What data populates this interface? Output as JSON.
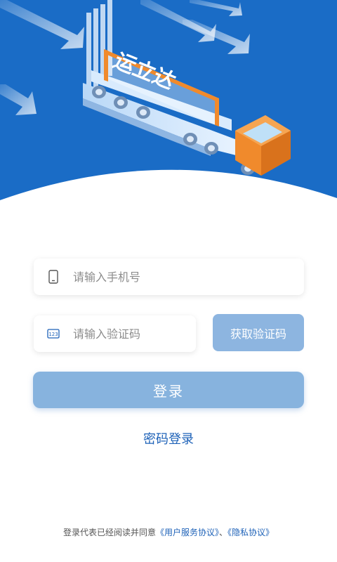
{
  "hero": {
    "brand_text": "运立达",
    "background_color": "#1a6cc6"
  },
  "login_form": {
    "phone_placeholder": "请输入手机号",
    "phone_value": "",
    "code_placeholder": "请输入验证码",
    "code_value": "",
    "get_code_label": "获取验证码",
    "login_label": "登录",
    "password_login_label": "密码登录"
  },
  "icons": {
    "phone": "phone-icon",
    "code": "keypad-icon"
  },
  "agreement": {
    "prefix": "登录代表已经阅读并同意",
    "user_agreement": "《用户服务协议》",
    "separator": "、",
    "privacy_agreement": "《隐私协议》"
  },
  "colors": {
    "primary": "#1e62b8",
    "button_disabled": "#87b3de"
  }
}
